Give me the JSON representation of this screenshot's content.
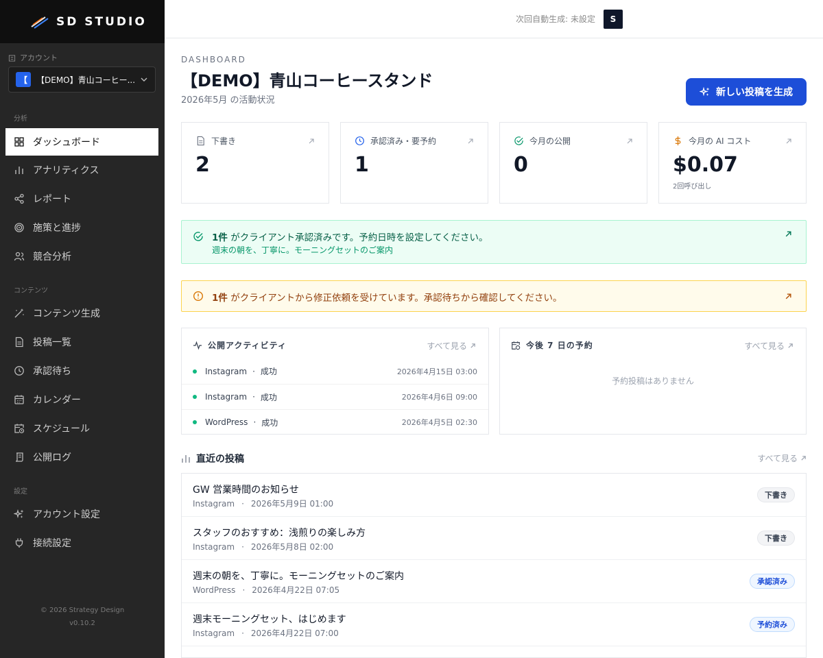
{
  "brand": {
    "name": "SD STUDIO"
  },
  "account": {
    "label": "アカウント",
    "selected": "【DEMO】青山コーヒー...",
    "badge": "【"
  },
  "nav": {
    "sections": {
      "analysis": "分析",
      "content": "コンテンツ",
      "settings": "設定"
    },
    "items": [
      {
        "label": "ダッシュボード",
        "icon": "grid-icon"
      },
      {
        "label": "アナリティクス",
        "icon": "bar-chart-icon"
      },
      {
        "label": "レポート",
        "icon": "share-icon"
      },
      {
        "label": "施策と進捗",
        "icon": "target-icon"
      },
      {
        "label": "競合分析",
        "icon": "users-icon"
      },
      {
        "label": "コンテンツ生成",
        "icon": "wand-icon"
      },
      {
        "label": "投稿一覧",
        "icon": "file-icon"
      },
      {
        "label": "承認待ち",
        "icon": "clock-icon"
      },
      {
        "label": "カレンダー",
        "icon": "calendar-icon"
      },
      {
        "label": "スケジュール",
        "icon": "calendar-clock-icon"
      },
      {
        "label": "公開ログ",
        "icon": "log-icon"
      },
      {
        "label": "アカウント設定",
        "icon": "sparkle-icon"
      },
      {
        "label": "接続設定",
        "icon": "plug-icon"
      }
    ]
  },
  "footer": {
    "copyright": "© 2026 Strategy Design",
    "version": "v0.10.2"
  },
  "topbar": {
    "status": "次回自動生成: 未設定",
    "avatar": "S"
  },
  "header": {
    "crumb": "DASHBOARD",
    "title": "【DEMO】青山コーヒースタンド",
    "subtitle": "2026年5月 の活動状況",
    "generate_button": "新しい投稿を生成"
  },
  "stats": [
    {
      "label": "下書き",
      "value": "2",
      "sub": ""
    },
    {
      "label": "承認済み・要予約",
      "value": "1",
      "sub": ""
    },
    {
      "label": "今月の公開",
      "value": "0",
      "sub": ""
    },
    {
      "label": "今月の AI コスト",
      "value": "$0.07",
      "sub": "2回呼び出し"
    }
  ],
  "banners": {
    "approved": {
      "count": "1件",
      "text": " がクライアント承認済みです。予約日時を設定してください。",
      "sub": "週末の朝を、丁寧に。モーニングセットのご案内"
    },
    "revision": {
      "count": "1件",
      "text": " がクライアントから修正依頼を受けています。承認待ちから確認してください。"
    }
  },
  "activity": {
    "title": "公開アクティビティ",
    "link": "すべて見る",
    "rows": [
      {
        "service": "Instagram",
        "status": "成功",
        "time": "2026年4月15日 03:00"
      },
      {
        "service": "Instagram",
        "status": "成功",
        "time": "2026年4月6日 09:00"
      },
      {
        "service": "WordPress",
        "status": "成功",
        "time": "2026年4月5日 02:30"
      }
    ]
  },
  "upcoming": {
    "title": "今後 7 日の予約",
    "link": "すべて見る",
    "empty": "予約投稿はありません"
  },
  "recent": {
    "title": "直近の投稿",
    "link": "すべて見る",
    "posts": [
      {
        "title": "GW 営業時間のお知らせ",
        "channel": "Instagram",
        "date": "2026年5月9日 01:00",
        "badge": "下書き"
      },
      {
        "title": "スタッフのおすすめ：浅煎りの楽しみ方",
        "channel": "Instagram",
        "date": "2026年5月8日 02:00",
        "badge": "下書き"
      },
      {
        "title": "週末の朝を、丁寧に。モーニングセットのご案内",
        "channel": "WordPress",
        "date": "2026年4月22日 07:05",
        "badge": "承認済み"
      },
      {
        "title": "週末モーニングセット、はじめます",
        "channel": "Instagram",
        "date": "2026年4月22日 07:00",
        "badge": "予約済み"
      }
    ]
  },
  "colors": {
    "accent": "#1d4ed8",
    "success": "#10b981",
    "sidebar": "#262626"
  }
}
